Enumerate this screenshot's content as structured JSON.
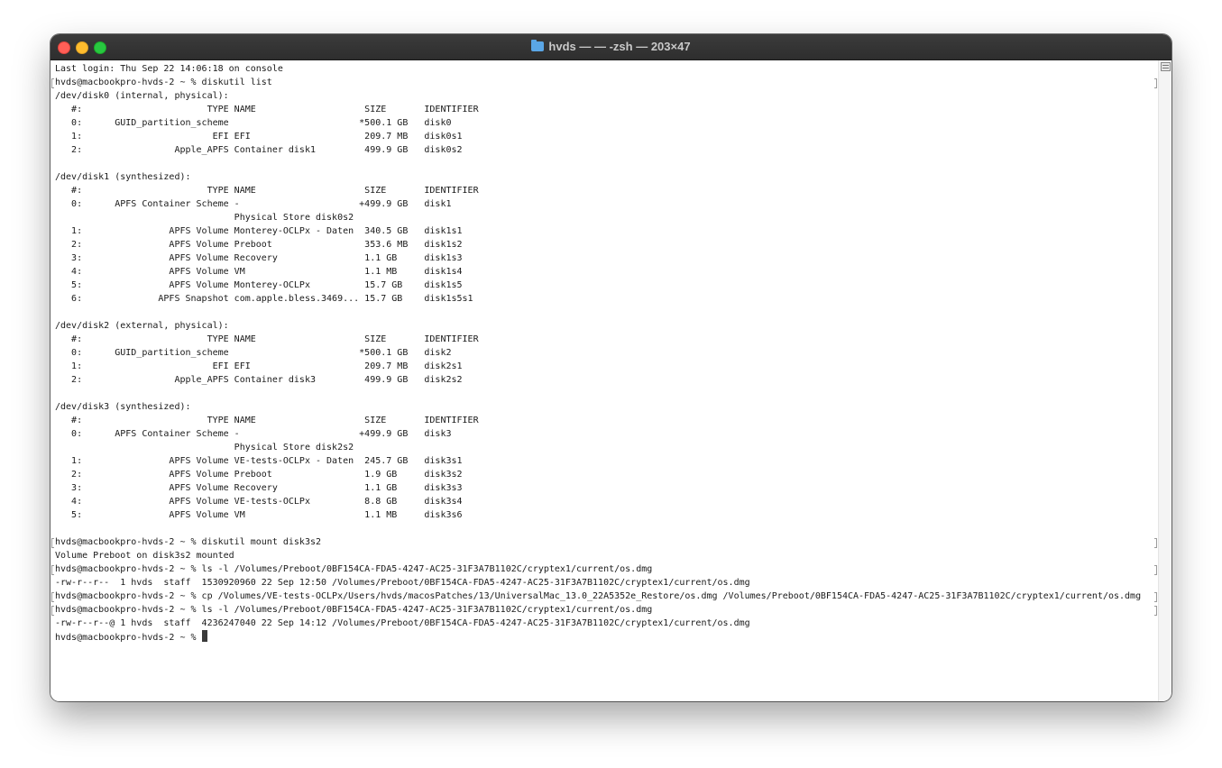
{
  "window": {
    "title": "hvds —   — -zsh — 203×47"
  },
  "terminal": {
    "lines": [
      "Last login: Thu Sep 22 14:06:18 on console",
      "hvds@macbookpro-hvds-2 ~ % diskutil list",
      "/dev/disk0 (internal, physical):",
      "   #:                       TYPE NAME                    SIZE       IDENTIFIER",
      "   0:      GUID_partition_scheme                        *500.1 GB   disk0",
      "   1:                        EFI EFI                     209.7 MB   disk0s1",
      "   2:                 Apple_APFS Container disk1         499.9 GB   disk0s2",
      "",
      "/dev/disk1 (synthesized):",
      "   #:                       TYPE NAME                    SIZE       IDENTIFIER",
      "   0:      APFS Container Scheme -                      +499.9 GB   disk1",
      "                                 Physical Store disk0s2",
      "   1:                APFS Volume Monterey-OCLPx - Daten  340.5 GB   disk1s1",
      "   2:                APFS Volume Preboot                 353.6 MB   disk1s2",
      "   3:                APFS Volume Recovery                1.1 GB     disk1s3",
      "   4:                APFS Volume VM                      1.1 MB     disk1s4",
      "   5:                APFS Volume Monterey-OCLPx          15.7 GB    disk1s5",
      "   6:              APFS Snapshot com.apple.bless.3469... 15.7 GB    disk1s5s1",
      "",
      "/dev/disk2 (external, physical):",
      "   #:                       TYPE NAME                    SIZE       IDENTIFIER",
      "   0:      GUID_partition_scheme                        *500.1 GB   disk2",
      "   1:                        EFI EFI                     209.7 MB   disk2s1",
      "   2:                 Apple_APFS Container disk3         499.9 GB   disk2s2",
      "",
      "/dev/disk3 (synthesized):",
      "   #:                       TYPE NAME                    SIZE       IDENTIFIER",
      "   0:      APFS Container Scheme -                      +499.9 GB   disk3",
      "                                 Physical Store disk2s2",
      "   1:                APFS Volume VE-tests-OCLPx - Daten  245.7 GB   disk3s1",
      "   2:                APFS Volume Preboot                 1.9 GB     disk3s2",
      "   3:                APFS Volume Recovery                1.1 GB     disk3s3",
      "   4:                APFS Volume VE-tests-OCLPx          8.8 GB     disk3s4",
      "   5:                APFS Volume VM                      1.1 MB     disk3s6",
      "",
      "hvds@macbookpro-hvds-2 ~ % diskutil mount disk3s2",
      "Volume Preboot on disk3s2 mounted",
      "hvds@macbookpro-hvds-2 ~ % ls -l /Volumes/Preboot/0BF154CA-FDA5-4247-AC25-31F3A7B1102C/cryptex1/current/os.dmg",
      "-rw-r--r--  1 hvds  staff  1530920960 22 Sep 12:50 /Volumes/Preboot/0BF154CA-FDA5-4247-AC25-31F3A7B1102C/cryptex1/current/os.dmg",
      "hvds@macbookpro-hvds-2 ~ % cp /Volumes/VE-tests-OCLPx/Users/hvds/macosPatches/13/UniversalMac_13.0_22A5352e_Restore/os.dmg /Volumes/Preboot/0BF154CA-FDA5-4247-AC25-31F3A7B1102C/cryptex1/current/os.dmg",
      "hvds@macbookpro-hvds-2 ~ % ls -l /Volumes/Preboot/0BF154CA-FDA5-4247-AC25-31F3A7B1102C/cryptex1/current/os.dmg",
      "-rw-r--r--@ 1 hvds  staff  4236247040 22 Sep 14:12 /Volumes/Preboot/0BF154CA-FDA5-4247-AC25-31F3A7B1102C/cryptex1/current/os.dmg",
      "hvds@macbookpro-hvds-2 ~ % "
    ]
  }
}
